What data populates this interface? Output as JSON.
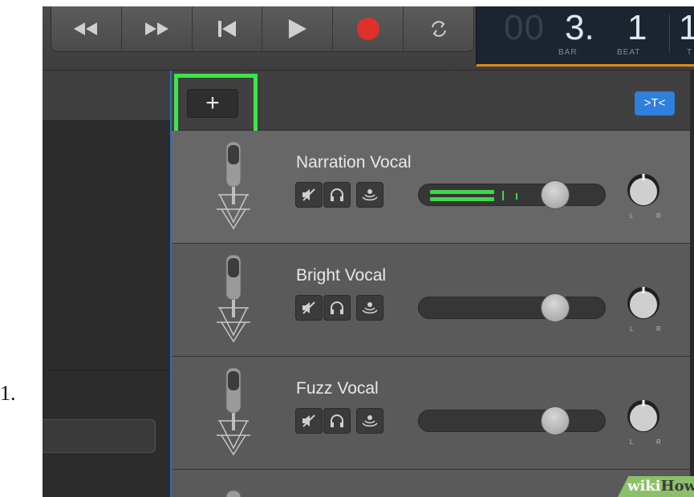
{
  "list_number": "1.",
  "lcd": {
    "bar_dim": "00",
    "bar_value": "3.",
    "beat_value": "1",
    "extra_value": "1",
    "bar_label": "BAR",
    "beat_label": "BEAT",
    "extra_label": "T"
  },
  "transport": [
    "rewind-icon",
    "fast-forward-icon",
    "go-to-start-icon",
    "play-icon",
    "record-icon",
    "cycle-icon"
  ],
  "toolbar": {
    "add_label": "+",
    "filter_label": ">T<"
  },
  "tracks": [
    {
      "name": "Narration Vocal",
      "selected": true,
      "meter_active": true,
      "knob_l": "L",
      "knob_r": "R"
    },
    {
      "name": "Bright Vocal",
      "selected": false,
      "meter_active": false,
      "knob_l": "L",
      "knob_r": "R"
    },
    {
      "name": "Fuzz Vocal",
      "selected": false,
      "meter_active": false,
      "knob_l": "L",
      "knob_r": "R"
    }
  ],
  "colors": {
    "highlight": "#3ee54a",
    "record": "#e0302a",
    "lcd_underline": "#d98a1e",
    "meter": "#3fd84a",
    "filter_button": "#2f7fdc"
  },
  "watermark": {
    "prefix": "wiki",
    "suffix": "How"
  }
}
